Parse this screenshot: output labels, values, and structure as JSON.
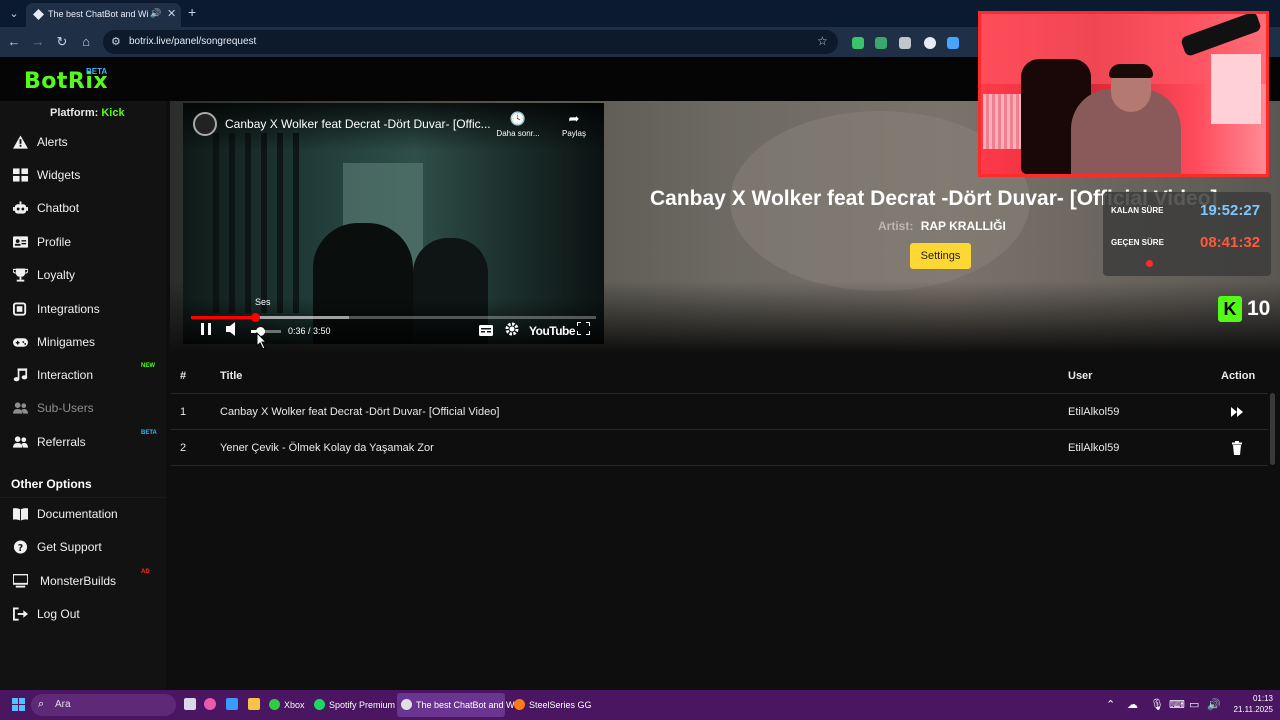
{
  "browser": {
    "tab_title": "The best ChatBot and Widg",
    "url": "botrix.live/panel/songrequest"
  },
  "brand": {
    "logo": "BotRix",
    "badge": "BETA"
  },
  "sidebar": {
    "platform_label": "Platform:",
    "platform_value": "Kick",
    "items": [
      {
        "label": "Alerts",
        "icon": "warning-icon"
      },
      {
        "label": "Widgets",
        "icon": "grid-icon"
      },
      {
        "label": "Chatbot",
        "icon": "robot-icon"
      },
      {
        "label": "Profile",
        "icon": "id-card-icon"
      },
      {
        "label": "Loyalty",
        "icon": "trophy-icon"
      },
      {
        "label": "Integrations",
        "icon": "plug-icon"
      },
      {
        "label": "Minigames",
        "icon": "gamepad-icon"
      },
      {
        "label": "Interaction",
        "icon": "music-icon",
        "badge": "NEW",
        "badge_color": "#53fc18"
      },
      {
        "label": "Sub-Users",
        "icon": "users-icon"
      },
      {
        "label": "Referrals",
        "icon": "people-icon",
        "badge": "BETA",
        "badge_color": "#39b5ff"
      }
    ],
    "other_title": "Other Options",
    "other_items": [
      {
        "label": "Documentation",
        "icon": "book-icon"
      },
      {
        "label": "Get Support",
        "icon": "help-icon"
      },
      {
        "label": "MonsterBuilds",
        "icon": "monitor-icon",
        "badge": "AD",
        "badge_color": "#ff2a2a"
      },
      {
        "label": "Log Out",
        "icon": "logout-icon"
      }
    ]
  },
  "now_playing": {
    "title": "Canbay X Wolker feat Decrat -Dört Duvar- [Official Video]",
    "artist_label": "Artist:",
    "artist": "RAP KRALLIĞI",
    "settings_label": "Settings"
  },
  "player": {
    "title": "Canbay X Wolker feat Decrat -Dört Duvar- [Offic...",
    "watch_later": "Daha sonr...",
    "share": "Paylaş",
    "tooltip": "Ses",
    "time": "0:36 / 3:50",
    "brand": "YouTube",
    "progress": 0.157,
    "buffered": 0.39,
    "volume": 0.3
  },
  "queue": {
    "headers": {
      "num": "#",
      "title": "Title",
      "user": "User",
      "action": "Action"
    },
    "rows": [
      {
        "num": "1",
        "title": "Canbay X Wolker feat Decrat -Dört Duvar- [Official Video]",
        "user": "EtilAlkol59",
        "action": "skip"
      },
      {
        "num": "2",
        "title": "Yener Çevik - Ölmek Kolay da Yaşamak Zor",
        "user": "EtilAlkol59",
        "action": "delete"
      }
    ]
  },
  "overlay": {
    "timer_remaining_label": "KALAN SÜRE",
    "timer_remaining": "19:52:27",
    "timer_elapsed_label": "GEÇEN SÜRE",
    "timer_elapsed": "08:41:32",
    "kick_viewers": "10",
    "colors": {
      "remaining": "#7cc8ff",
      "elapsed": "#ff5a3a",
      "kick": "#53fc18"
    }
  },
  "taskbar": {
    "search_placeholder": "Ara",
    "tasks": [
      {
        "label": "Xbox"
      },
      {
        "label": "Spotify Premium"
      },
      {
        "label": "The best ChatBot and W"
      },
      {
        "label": "SteelSeries GG"
      }
    ],
    "time": "01:13",
    "date": "21.11.2025"
  }
}
